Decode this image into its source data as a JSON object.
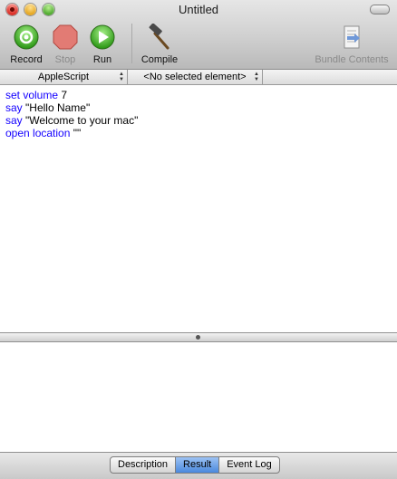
{
  "window": {
    "title": "Untitled"
  },
  "toolbar": {
    "record_label": "Record",
    "stop_label": "Stop",
    "run_label": "Run",
    "compile_label": "Compile",
    "bundle_label": "Bundle Contents"
  },
  "navigation": {
    "language": "AppleScript",
    "element": "<No selected element>"
  },
  "script": {
    "lines": [
      {
        "keyword": "set volume",
        "rest": " 7"
      },
      {
        "keyword": "say",
        "rest": " \"Hello Name\""
      },
      {
        "keyword": "say",
        "rest": " \"Welcome to your mac\""
      },
      {
        "keyword": "open location",
        "rest": " \"\""
      }
    ]
  },
  "result_tabs": {
    "items": [
      "Description",
      "Result",
      "Event Log"
    ],
    "selected": "Result"
  },
  "colors": {
    "keyword": "#1400ff",
    "selected_tab": "#4a88dd"
  }
}
